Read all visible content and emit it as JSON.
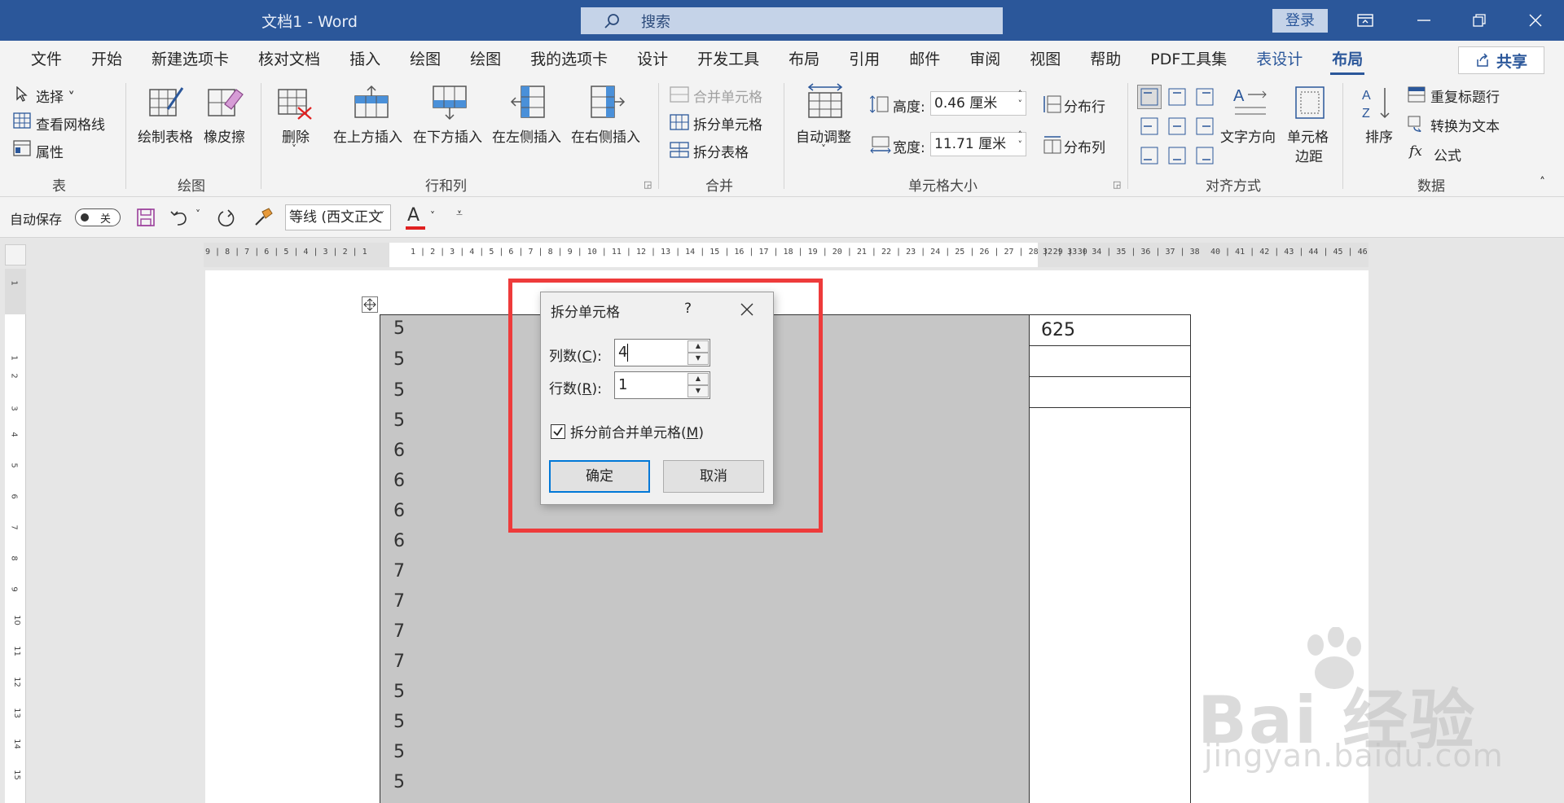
{
  "window": {
    "title": "文档1  -  Word",
    "search_placeholder": "搜索",
    "login": "登录"
  },
  "tabs": [
    "文件",
    "开始",
    "新建选项卡",
    "核对文档",
    "插入",
    "绘图",
    "绘图",
    "我的选项卡",
    "设计",
    "开发工具",
    "布局",
    "引用",
    "邮件",
    "审阅",
    "视图",
    "帮助",
    "PDF工具集",
    "表设计",
    "布局"
  ],
  "share": "共享",
  "ribbon": {
    "table": {
      "select": "选择",
      "gridlines": "查看网格线",
      "properties": "属性",
      "label": "表"
    },
    "draw": {
      "draw_table": "绘制表格",
      "eraser": "橡皮擦",
      "label": "绘图"
    },
    "rows_cols": {
      "delete": "删除",
      "insert_above": "在上方插入",
      "insert_below": "在下方插入",
      "insert_left": "在左侧插入",
      "insert_right": "在右侧插入",
      "label": "行和列"
    },
    "merge": {
      "merge_cells": "合并单元格",
      "split_cells": "拆分单元格",
      "split_table": "拆分表格",
      "label": "合并"
    },
    "cell_size": {
      "autofit": "自动调整",
      "height_label": "高度:",
      "height_value": "0.46 厘米",
      "width_label": "宽度:",
      "width_value": "11.71 厘米",
      "distribute_rows": "分布行",
      "distribute_cols": "分布列",
      "label": "单元格大小"
    },
    "alignment": {
      "text_direction": "文字方向",
      "cell_margins_1": "单元格",
      "cell_margins_2": "边距",
      "label": "对齐方式"
    },
    "data": {
      "sort": "排序",
      "repeat_header": "重复标题行",
      "convert_text": "转换为文本",
      "formula": "公式",
      "label": "数据"
    }
  },
  "qat": {
    "autosave": "自动保存",
    "toggle_state": "关",
    "font_name": "等线 (西文正文"
  },
  "ruler": {
    "h_left": "9 | 8 | 7 | 6 | 5 | 4 | 3 | 2 | 1",
    "h_main": "1 | 2 | 3 | 4 | 5 | 6 | 7 | 8 | 9 | 10 | 11 | 12 | 13 | 14 | 15 | 16 | 17 | 18 | 19 | 20 | 21 | 22 | 23 | 24 | 25 | 26 | 27 | 28 | 29 | 30",
    "h_right": "32 | 33 | 34 | 35 | 36 | 37 | 38",
    "h_far": "40 | 41 | 42 | 43 | 44 | 45 | 46 | 47",
    "v_nums": [
      "1",
      "1",
      "2",
      "3",
      "4",
      "5",
      "6",
      "7",
      "8",
      "9",
      "10",
      "11",
      "12",
      "13",
      "14",
      "15"
    ]
  },
  "table": {
    "col1": [
      "5",
      "5",
      "5",
      "5",
      "6",
      "6",
      "6",
      "6",
      "7",
      "7",
      "7",
      "7",
      "5",
      "5",
      "5",
      "5"
    ],
    "col2": [
      "625",
      "",
      ""
    ]
  },
  "dialog": {
    "title": "拆分单元格",
    "help": "?",
    "cols_label_pre": "列数(",
    "cols_key": "C",
    "cols_label_post": "):",
    "cols_value": "4",
    "rows_label_pre": "行数(",
    "rows_key": "R",
    "rows_label_post": "):",
    "rows_value": "1",
    "merge_before_pre": "拆分前合并单元格(",
    "merge_before_key": "M",
    "merge_before_post": ")",
    "ok": "确定",
    "cancel": "取消"
  },
  "watermark": {
    "line1": "Bai  经验",
    "line2": "jingyan.baidu.com"
  }
}
